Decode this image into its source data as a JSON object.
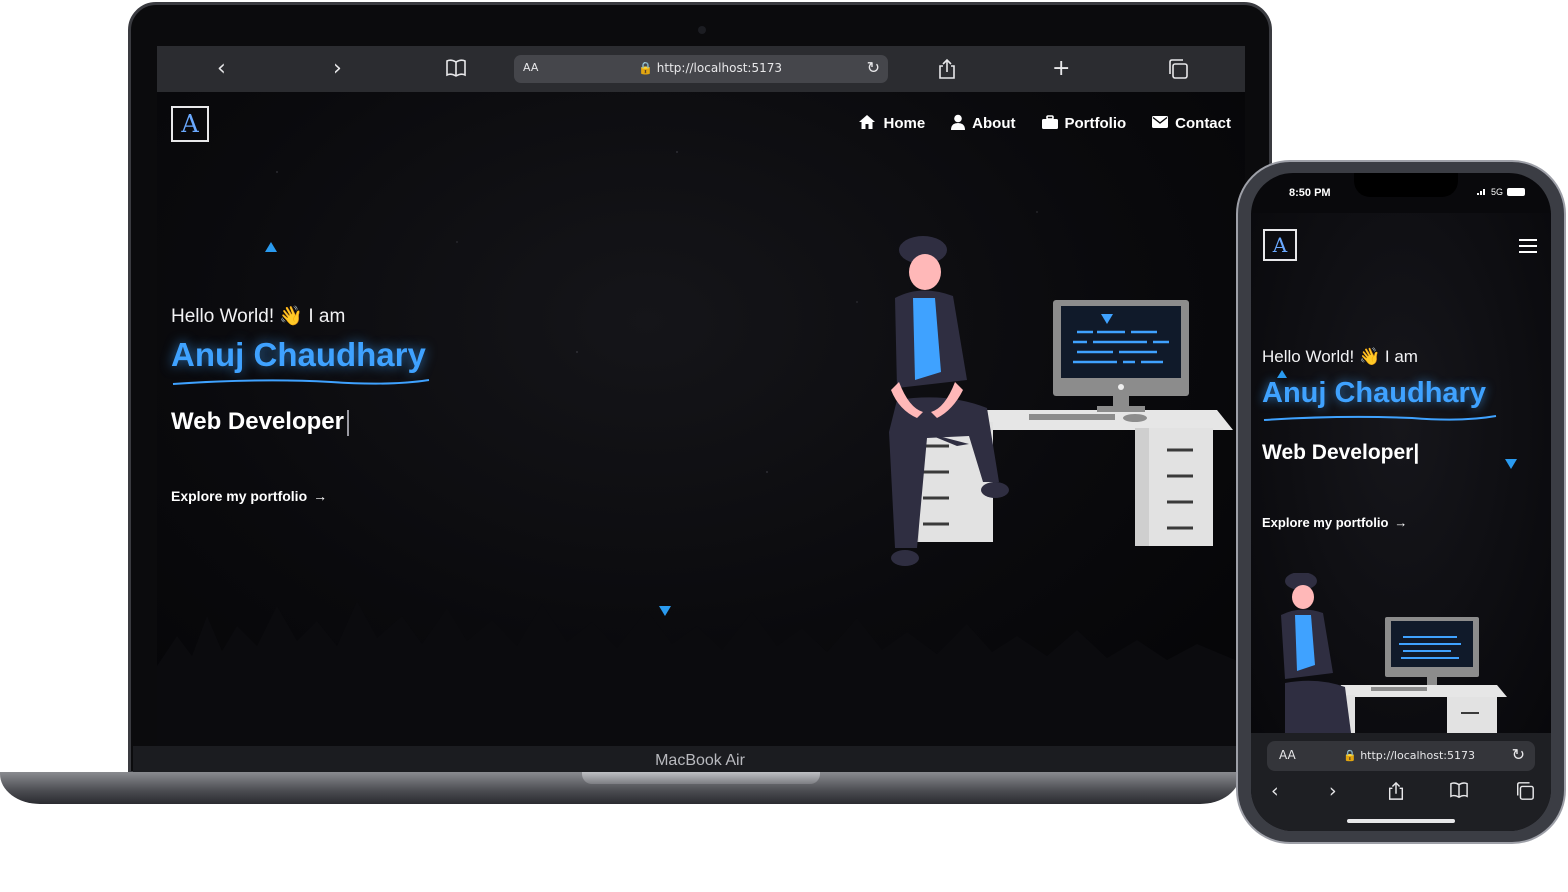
{
  "laptop": {
    "device_label": "MacBook Air",
    "browser": {
      "text_size_label": "AA",
      "url": "http://localhost:5173"
    },
    "site": {
      "logo_letter": "A",
      "nav": [
        {
          "label": "Home",
          "icon": "home-icon"
        },
        {
          "label": "About",
          "icon": "user-icon"
        },
        {
          "label": "Portfolio",
          "icon": "briefcase-icon"
        },
        {
          "label": "Contact",
          "icon": "envelope-icon"
        }
      ],
      "greeting": "Hello World! 👋 I am",
      "name": "Anuj Chaudhary",
      "role": "Web Developer",
      "cta": "Explore my portfolio",
      "cta_arrow": "→"
    }
  },
  "phone": {
    "time": "8:50 PM",
    "network": "5G",
    "site": {
      "logo_letter": "A",
      "greeting": "Hello World! 👋 I am",
      "name": "Anuj Chaudhary",
      "role": "Web Developer|",
      "cta": "Explore my portfolio",
      "cta_arrow": "→"
    },
    "browser": {
      "text_size_label": "AA",
      "url": "http://localhost:5173"
    }
  },
  "colors": {
    "accent": "#3fa2ff",
    "triangle": "#2a9bf0",
    "background": "#050508"
  }
}
